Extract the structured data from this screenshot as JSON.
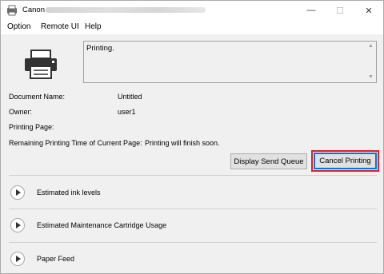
{
  "window": {
    "title": "Canon",
    "minimize_glyph": "—",
    "maximize_glyph": "☐",
    "close_glyph": "✕"
  },
  "menu": {
    "option": "Option",
    "remote_ui": "Remote UI",
    "help": "Help"
  },
  "status": {
    "message": "Printing.",
    "scroll_up_glyph": "▲",
    "scroll_down_glyph": "▼"
  },
  "info": {
    "document_name_label": "Document Name:",
    "document_name_value": "Untitled",
    "owner_label": "Owner:",
    "owner_value": "user1",
    "printing_page_label": "Printing Page:",
    "remaining_label": "Remaining Printing Time of Current Page:",
    "remaining_value": "Printing will finish soon."
  },
  "buttons": {
    "display_send_queue": "Display Send Queue",
    "cancel_printing": "Cancel Printing"
  },
  "sections": [
    {
      "label": "Estimated ink levels"
    },
    {
      "label": "Estimated Maintenance Cartridge Usage"
    },
    {
      "label": "Paper Feed"
    }
  ],
  "colors": {
    "highlight_box": "#e02020",
    "focus_border": "#0078d7"
  }
}
